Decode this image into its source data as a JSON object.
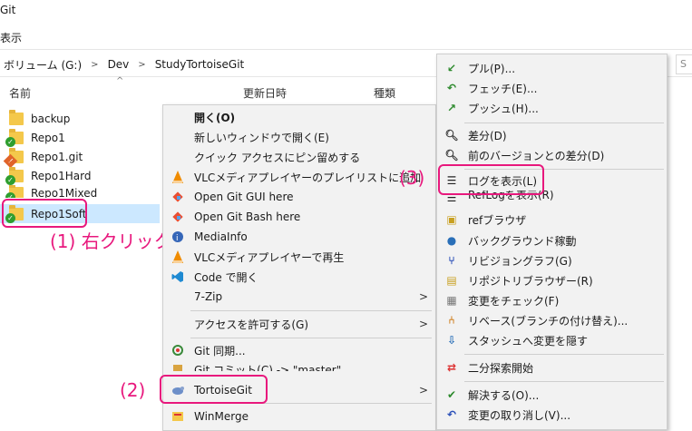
{
  "window": {
    "title": "Git",
    "menu_view": "表示"
  },
  "address": {
    "crumbs": [
      "ボリューム (G:)",
      "Dev",
      "StudyTortoiseGit"
    ],
    "search_placeholder": "S"
  },
  "columns": {
    "name": "名前",
    "modified": "更新日時",
    "type": "種類"
  },
  "files": [
    {
      "name": "backup",
      "status": "folder"
    },
    {
      "name": "Repo1",
      "status": "ok"
    },
    {
      "name": "Repo1.git",
      "status": "modified"
    },
    {
      "name": "Repo1Hard",
      "status": "ok"
    },
    {
      "name": "Repo1Mixed",
      "status": "ok"
    },
    {
      "name": "Repo1Soft",
      "status": "ok"
    }
  ],
  "context_menu": [
    {
      "label": "開く(O)",
      "icon": "none",
      "bold": true
    },
    {
      "label": "新しいウィンドウで開く(E)",
      "icon": "none"
    },
    {
      "label": "クイック アクセスにピン留めする",
      "icon": "none"
    },
    {
      "label": "VLCメディアプレイヤーのプレイリストに追加",
      "icon": "vlc-icon"
    },
    {
      "label": "Open Git GUI here",
      "icon": "git-gui-icon"
    },
    {
      "label": "Open Git Bash here",
      "icon": "git-bash-icon"
    },
    {
      "label": "MediaInfo",
      "icon": "mediainfo-icon"
    },
    {
      "label": "VLCメディアプレイヤーで再生",
      "icon": "vlc-icon"
    },
    {
      "label": "Code で開く",
      "icon": "vscode-icon"
    },
    {
      "label": "7-Zip",
      "icon": "none",
      "submenu": true
    },
    {
      "label": "アクセスを許可する(G)",
      "icon": "none",
      "submenu": true
    },
    {
      "label": "Git 同期...",
      "icon": "git-sync-icon"
    },
    {
      "label": "Git コミット(C) -> \"master\"...",
      "icon": "git-commit-icon"
    },
    {
      "label": "TortoiseGit",
      "icon": "tortoisegit-icon",
      "submenu": true
    },
    {
      "label": "WinMerge",
      "icon": "winmerge-icon"
    }
  ],
  "submenu": [
    {
      "label": "プル(P)...",
      "icon": "pull-icon"
    },
    {
      "label": "フェッチ(E)...",
      "icon": "fetch-icon"
    },
    {
      "label": "プッシュ(H)...",
      "icon": "push-icon"
    },
    {
      "label": "差分(D)",
      "icon": "diff-icon"
    },
    {
      "label": "前のバージョンとの差分(D)",
      "icon": "diff-prev-icon"
    },
    {
      "label": "ログを表示(L)",
      "icon": "log-icon"
    },
    {
      "label": "RefLogを表示(R)",
      "icon": "reflog-icon"
    },
    {
      "label": "refブラウザ",
      "icon": "ref-browser-icon"
    },
    {
      "label": "バックグラウンド稼動",
      "icon": "daemon-icon"
    },
    {
      "label": "リビジョングラフ(G)",
      "icon": "revision-graph-icon"
    },
    {
      "label": "リポジトリブラウザー(R)",
      "icon": "repo-browser-icon"
    },
    {
      "label": "変更をチェック(F)",
      "icon": "check-modifications-icon"
    },
    {
      "label": "リベース(ブランチの付け替え)...",
      "icon": "rebase-icon"
    },
    {
      "label": "スタッシュへ変更を隠す",
      "icon": "stash-icon"
    },
    {
      "label": "二分探索開始",
      "icon": "bisect-icon"
    },
    {
      "label": "解決する(O)...",
      "icon": "resolve-icon"
    },
    {
      "label": "変更の取り消し(V)...",
      "icon": "revert-icon"
    }
  ],
  "annotations": {
    "step1": "(1) 右クリック",
    "step2": "(2)",
    "step3": "(3)"
  },
  "colors": {
    "annotation": "#e8187d",
    "selection": "#cce8ff"
  }
}
